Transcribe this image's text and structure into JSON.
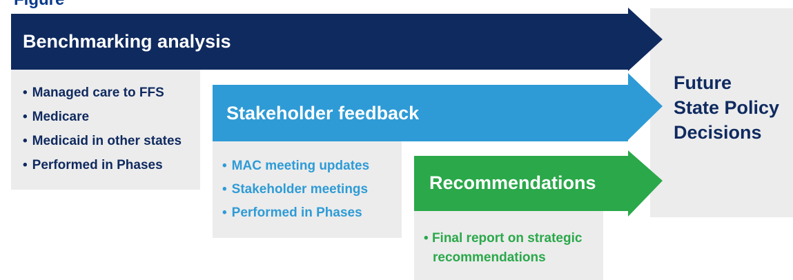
{
  "figure_title": "Figure",
  "colors": {
    "navy": "#0f2a5f",
    "light_blue": "#2e9bd6",
    "green": "#2aa84a",
    "panel_gray": "#ececec"
  },
  "benchmarking": {
    "title": "Benchmarking analysis",
    "bullets": [
      "Managed care to FFS",
      "Medicare",
      "Medicaid in other states",
      "Performed in Phases"
    ]
  },
  "stakeholder": {
    "title": "Stakeholder feedback",
    "bullets": [
      "MAC meeting updates",
      "Stakeholder meetings",
      "Performed in Phases"
    ]
  },
  "recommendations": {
    "title": "Recommendations",
    "bullets": [
      "Final report on strategic",
      "recommendations"
    ]
  },
  "future": {
    "lines": [
      "Future",
      "State Policy",
      "Decisions"
    ]
  }
}
